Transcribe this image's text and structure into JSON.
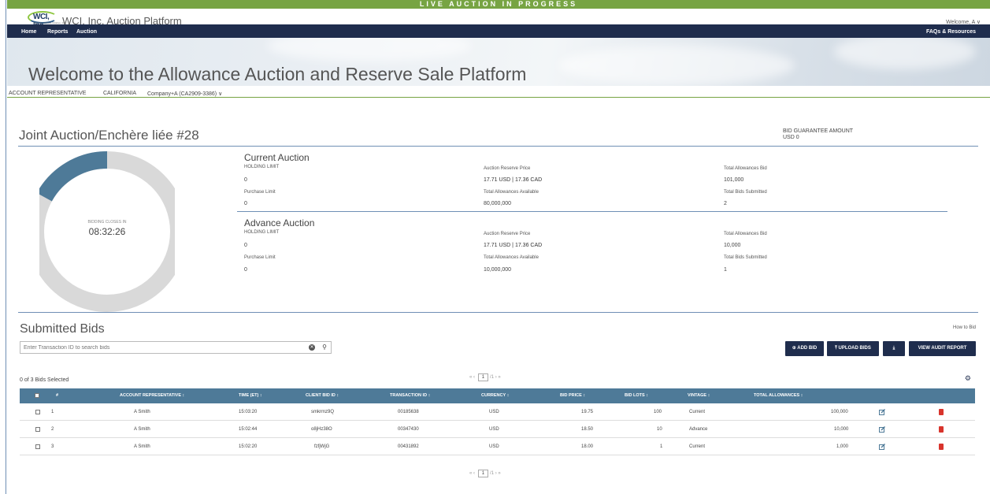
{
  "banner": "LIVE AUCTION IN PROGRESS",
  "brand": {
    "logo_text": "WCI, Inc.",
    "logo_sub": "Western Climate Initiative, Inc.",
    "title": "WCI, Inc. Auction Platform",
    "welcome": "Welcome, A ∨"
  },
  "nav": {
    "home": "Home",
    "reports": "Reports",
    "auction": "Auction",
    "faq": "FAQs & Resources"
  },
  "hero_title": "Welcome to the Allowance Auction and Reserve Sale Platform",
  "account": {
    "role": "ACCOUNT REPRESENTATIVE",
    "jurisdiction": "CALIFORNIA",
    "company": "Company+A (CA2909-3386) ∨"
  },
  "auction": {
    "title": "Joint Auction/Enchère liée #28",
    "bid_guarantee_label": "BID GUARANTEE AMOUNT",
    "bid_guarantee_value": "USD 0",
    "closes_label": "BIDDING CLOSES IN",
    "closes_time": "08:32:26",
    "progress_fraction": 0.17,
    "current": {
      "title": "Current Auction",
      "holding_limit_label": "HOLDING LIMIT",
      "holding_limit": "0",
      "purchase_limit_label": "Purchase Limit",
      "purchase_limit": "0",
      "reserve_price_label": "Auction Reserve Price",
      "reserve_price": "17.71 USD | 17.36 CAD",
      "allowances_available_label": "Total Allowances Available",
      "allowances_available": "80,000,000",
      "allowances_bid_label": "Total Allowances Bid",
      "allowances_bid": "101,000",
      "bids_submitted_label": "Total Bids Submitted",
      "bids_submitted": "2"
    },
    "advance": {
      "title": "Advance Auction",
      "holding_limit_label": "HOLDING LIMIT",
      "holding_limit": "0",
      "purchase_limit_label": "Purchase Limit",
      "purchase_limit": "0",
      "reserve_price_label": "Auction Reserve Price",
      "reserve_price": "17.71 USD | 17.36 CAD",
      "allowances_available_label": "Total Allowances Available",
      "allowances_available": "10,000,000",
      "allowances_bid_label": "Total Allowances Bid",
      "allowances_bid": "10,000",
      "bids_submitted_label": "Total Bids Submitted",
      "bids_submitted": "1"
    }
  },
  "bids": {
    "title": "Submitted Bids",
    "how_to": "How to Bid",
    "search_placeholder": "Enter Transaction ID to search bids",
    "buttons": {
      "add": "ADD BID",
      "upload": "UPLOAD BIDS",
      "audit": "VIEW AUDIT REPORT"
    },
    "selected": "0 of 3 Bids Selected",
    "pager": {
      "first": "«",
      "prev": "‹",
      "page": "1",
      "total": "/1",
      "next": "›",
      "last": "»"
    },
    "columns": {
      "num": "#",
      "rep": "ACCOUNT REPRESENTATIVE ↕",
      "time": "TIME (ET) ↕",
      "client": "CLIENT BID ID ↕",
      "txn": "TRANSACTION ID ↕",
      "currency": "CURRENCY ↕",
      "price": "BID PRICE ↕",
      "lots": "BID LOTS ↕",
      "vintage": "VINTAGE ↕",
      "total": "TOTAL ALLOWANCES ↕"
    },
    "rows": [
      {
        "num": "1",
        "rep": "A Smith",
        "time": "15:03:20",
        "client": "smkrmz9Q",
        "txn": "00185638",
        "currency": "USD",
        "price": "19.75",
        "lots": "100",
        "vintage": "Current",
        "total": "100,000"
      },
      {
        "num": "2",
        "rep": "A Smith",
        "time": "15:02:44",
        "client": "o8jHz38O",
        "txn": "00347430",
        "currency": "USD",
        "price": "18.50",
        "lots": "10",
        "vintage": "Advance",
        "total": "10,000"
      },
      {
        "num": "3",
        "rep": "A Smith",
        "time": "15:02:20",
        "client": "fzfjWjG",
        "txn": "00431892",
        "currency": "USD",
        "price": "18.00",
        "lots": "1",
        "vintage": "Current",
        "total": "1,000"
      }
    ]
  },
  "colors": {
    "banner_green": "#77a443",
    "nav_navy": "#1f2d4d",
    "donut_fill": "#4e7a98",
    "donut_track": "#d9d9d9",
    "delete_red": "#d8342c"
  }
}
